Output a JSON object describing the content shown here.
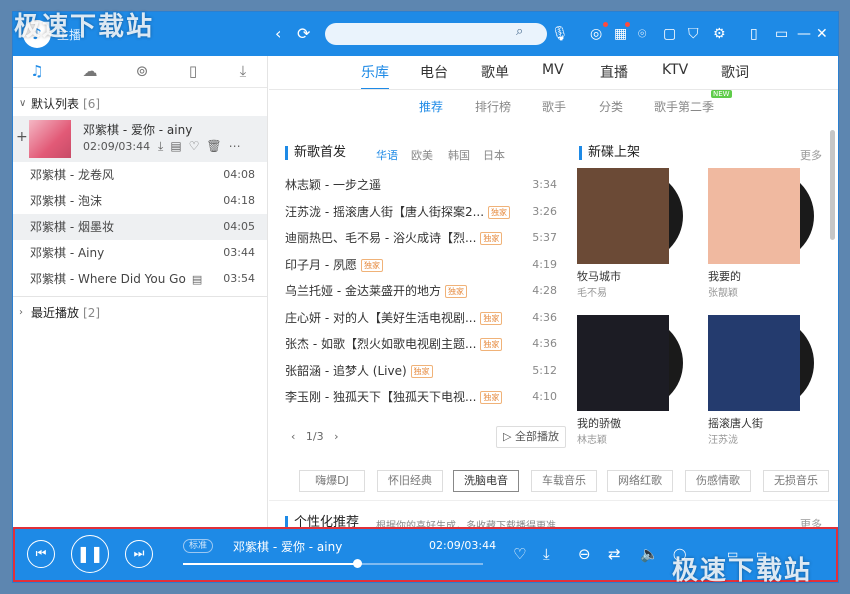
{
  "watermark": {
    "text": "极速下载站"
  },
  "topbar": {
    "logo_icon": "music-note-logo",
    "user_label": "主播",
    "back_icon": "‹",
    "refresh_icon": "⟳",
    "search_placeholder": "",
    "icons": [
      "mic-icon",
      "record-icon",
      "grid-icon",
      "gamepad-icon",
      "shirt-icon",
      "gear-icon",
      "phone-icon",
      "minimize-icon",
      "close-icon"
    ]
  },
  "left": {
    "tabs": [
      "music-icon",
      "cloud-icon",
      "radio-icon",
      "device-icon",
      "download-icon"
    ],
    "group1": {
      "label": "默认列表",
      "count": "[6]"
    },
    "now_playing": {
      "title": "邓紫棋 - 爱你 - ainy",
      "time": "02:09/03:44"
    },
    "songs": [
      {
        "title": "邓紫棋 - 龙卷风",
        "duration": "04:08"
      },
      {
        "title": "邓紫棋 - 泡沫",
        "duration": "04:18"
      },
      {
        "title": "邓紫棋 - 烟墨妆",
        "duration": "04:05"
      },
      {
        "title": "邓紫棋 - Ainy",
        "duration": "03:44"
      },
      {
        "title": "邓紫棋 - Where Did You Go",
        "duration": "03:54"
      }
    ],
    "group2": {
      "label": "最近播放",
      "count": "[2]"
    }
  },
  "main": {
    "tabs": [
      "乐库",
      "电台",
      "歌单",
      "MV",
      "直播",
      "KTV",
      "歌词"
    ],
    "subtabs": [
      "推荐",
      "排行榜",
      "歌手",
      "分类",
      "歌手第二季"
    ],
    "new_badge": "NEW",
    "new_songs": {
      "title": "新歌首发",
      "filters": [
        "华语",
        "欧美",
        "韩国",
        "日本"
      ],
      "songs": [
        {
          "title": "林志颖 - 一步之遥",
          "tag": "",
          "duration": "3:34"
        },
        {
          "title": "汪苏泷 - 摇滚唐人街【唐人街探案2...",
          "tag": "独家",
          "duration": "3:26"
        },
        {
          "title": "迪丽热巴、毛不易 - 浴火成诗【烈...",
          "tag": "独家",
          "duration": "5:37"
        },
        {
          "title": "印子月 - 夙愿",
          "tag": "独家",
          "duration": "4:19"
        },
        {
          "title": "乌兰托娅 - 金达莱盛开的地方",
          "tag": "独家",
          "duration": "4:28"
        },
        {
          "title": "庄心妍 - 对的人【美好生活电视剧...",
          "tag": "独家",
          "duration": "4:36"
        },
        {
          "title": "张杰 - 如歌【烈火如歌电视剧主题...",
          "tag": "独家",
          "duration": "4:36"
        },
        {
          "title": "张韶涵 - 追梦人 (Live)",
          "tag": "独家",
          "duration": "5:12"
        },
        {
          "title": "李玉刚 - 独孤天下【独孤天下电视...",
          "tag": "独家",
          "duration": "4:10"
        }
      ],
      "pager": "1/3",
      "play_all": "全部播放"
    },
    "new_albums": {
      "title": "新碟上架",
      "more": "更多",
      "albums": [
        {
          "name": "牧马城市",
          "artist": "毛不易",
          "color": "#6b4a36"
        },
        {
          "name": "我要的",
          "artist": "张靓颖",
          "color": "#f0b9a0"
        },
        {
          "name": "我的骄傲",
          "artist": "林志颖",
          "color": "#1c1c24"
        },
        {
          "name": "摇滚唐人街",
          "artist": "汪苏泷",
          "color": "#243b6e"
        }
      ]
    },
    "genres": [
      "嗨爆DJ",
      "怀旧经典",
      "洗脑电音",
      "车载音乐",
      "网络红歌",
      "伤感情歌",
      "无损音乐"
    ],
    "personal": {
      "title": "个性化推荐",
      "subtitle": "根据你的喜好生成，多收藏下载播得更准",
      "more": "更多"
    }
  },
  "player": {
    "quality": "标准",
    "title": "邓紫棋 - 爱你 - ainy",
    "time": "02:09/03:44",
    "progress": 0.58
  }
}
